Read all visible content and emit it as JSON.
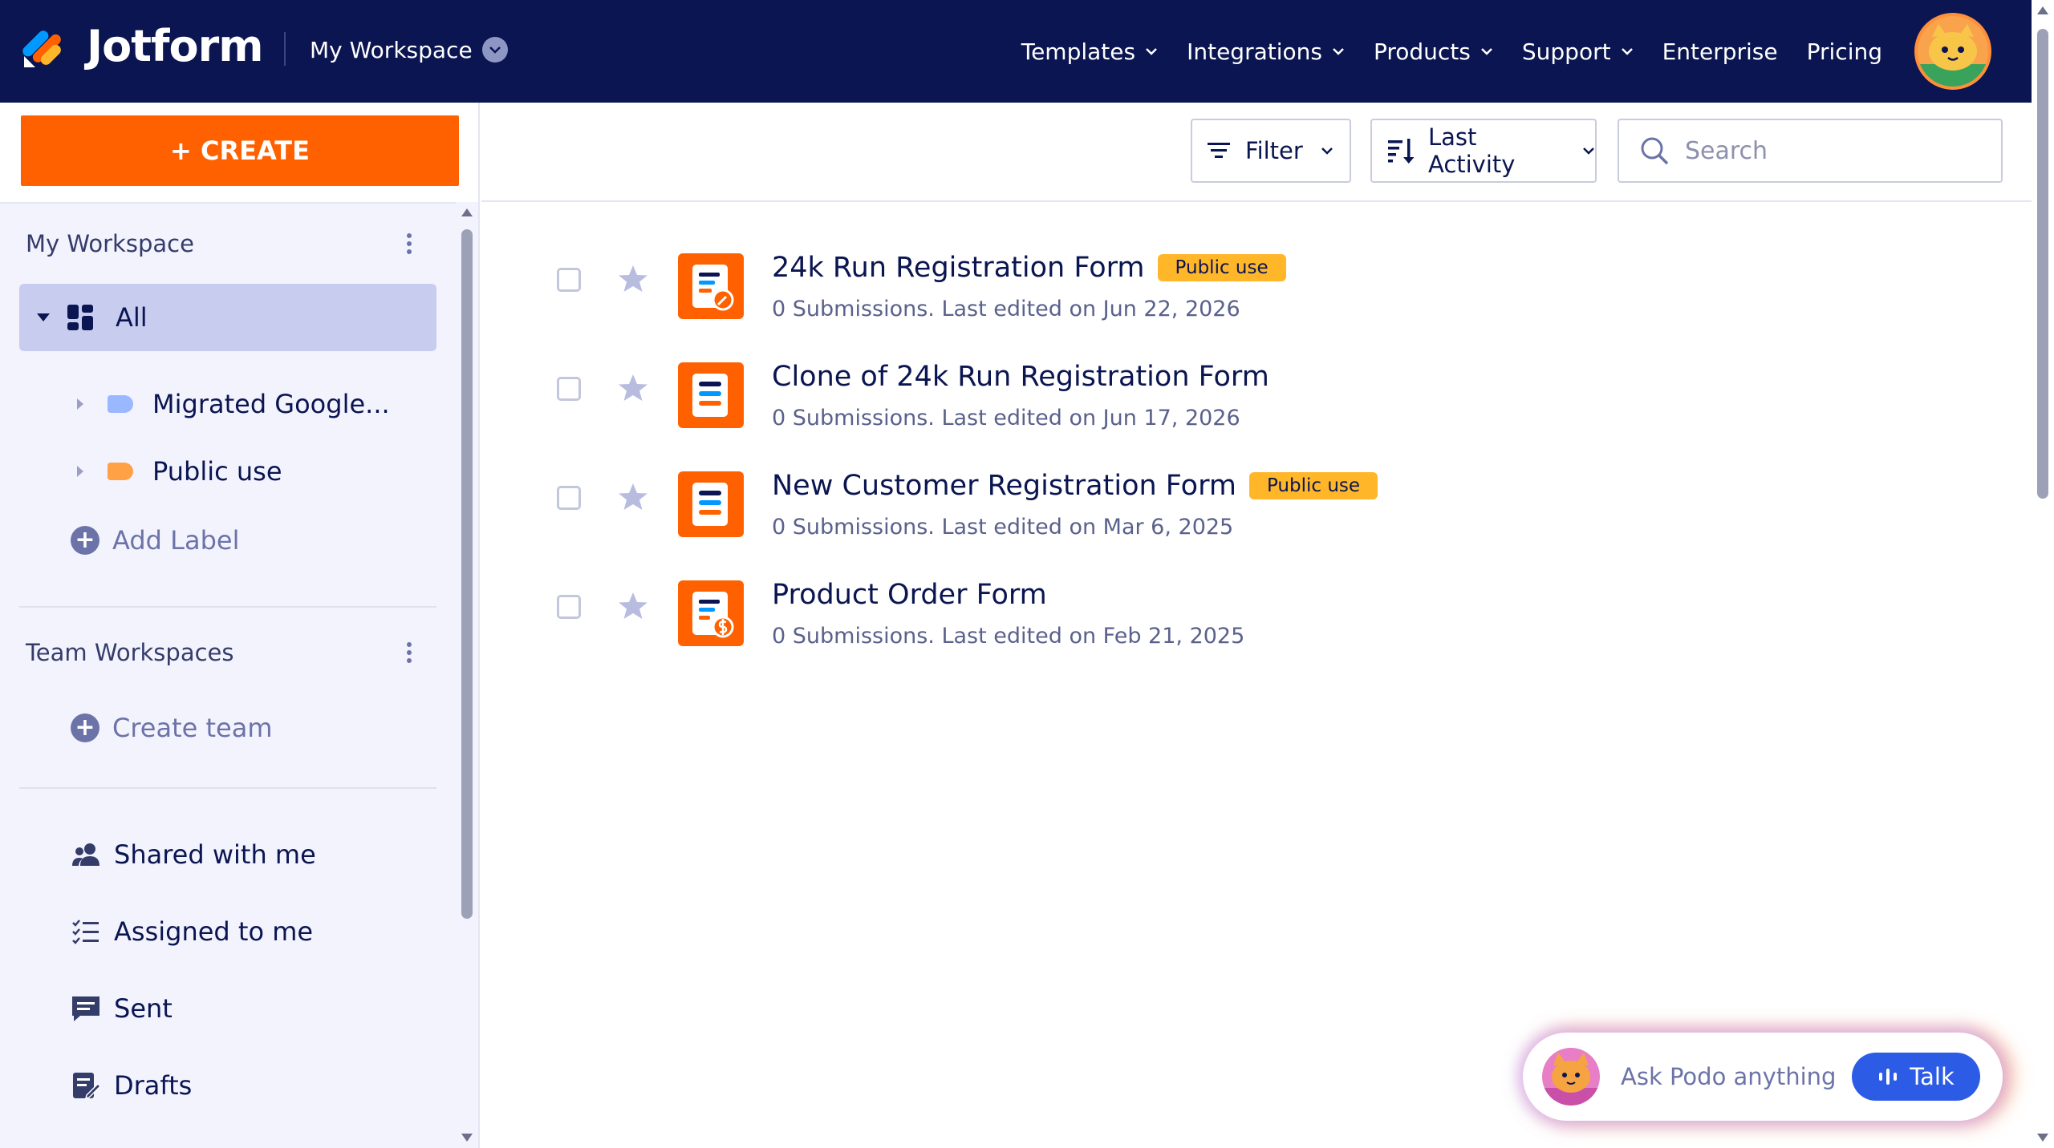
{
  "brand": {
    "name": "Jotform",
    "accent": "#ff6100",
    "navy": "#0a1551"
  },
  "header": {
    "workspace_switch": "My Workspace",
    "nav": [
      {
        "label": "Templates",
        "dropdown": true
      },
      {
        "label": "Integrations",
        "dropdown": true
      },
      {
        "label": "Products",
        "dropdown": true
      },
      {
        "label": "Support",
        "dropdown": true
      },
      {
        "label": "Enterprise",
        "dropdown": false
      },
      {
        "label": "Pricing",
        "dropdown": false
      }
    ]
  },
  "sidebar": {
    "create_label": "+ CREATE",
    "my_workspace": {
      "title": "My Workspace",
      "all_label": "All",
      "labels": [
        {
          "name": "Migrated Google...",
          "color": "#9ab8ff"
        },
        {
          "name": "Public use",
          "color": "#ffa144"
        }
      ],
      "add_label": "Add Label"
    },
    "team_workspaces": {
      "title": "Team Workspaces",
      "create_team": "Create team"
    },
    "links": [
      {
        "label": "Shared with me",
        "icon": "users-icon"
      },
      {
        "label": "Assigned to me",
        "icon": "checklist-icon"
      },
      {
        "label": "Sent",
        "icon": "message-icon"
      },
      {
        "label": "Drafts",
        "icon": "draft-icon"
      }
    ]
  },
  "toolbar": {
    "filter_label": "Filter",
    "sort_label": "Last Activity",
    "search_placeholder": "Search"
  },
  "forms": [
    {
      "title": "24k Run Registration Form",
      "badge": "Public use",
      "meta": "0 Submissions. Last edited on Jun 22, 2026",
      "icon": "form-edit-icon"
    },
    {
      "title": "Clone of 24k Run Registration Form",
      "badge": null,
      "meta": "0 Submissions. Last edited on Jun 17, 2026",
      "icon": "form-icon"
    },
    {
      "title": "New Customer Registration Form",
      "badge": "Public use",
      "meta": "0 Submissions. Last edited on Mar 6, 2025",
      "icon": "form-icon"
    },
    {
      "title": "Product Order Form",
      "badge": null,
      "meta": "0 Submissions. Last edited on Feb 21, 2025",
      "icon": "form-payment-icon"
    }
  ],
  "podo": {
    "prompt": "Ask Podo anything",
    "talk_label": "Talk"
  }
}
